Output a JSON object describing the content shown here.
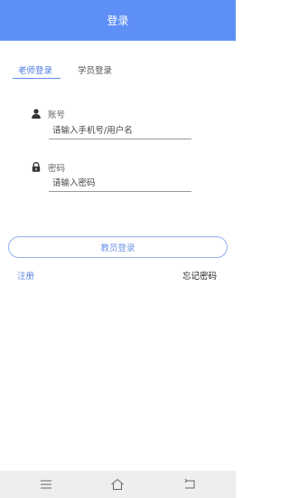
{
  "header": {
    "title": "登录"
  },
  "tabs": [
    {
      "label": "老师登录",
      "active": true
    },
    {
      "label": "学员登录",
      "active": false
    }
  ],
  "account": {
    "icon": "user-icon",
    "label": "账号",
    "placeholder": "请输入手机号/用户名",
    "value": ""
  },
  "password": {
    "icon": "lock-icon",
    "label": "密码",
    "placeholder": "请输入密码",
    "value": ""
  },
  "login_button": {
    "label": "教员登录"
  },
  "links": {
    "register": "注册",
    "forgot": "忘记密码"
  },
  "navbar": {
    "icons": [
      "menu-icon",
      "home-icon",
      "back-icon"
    ]
  },
  "colors": {
    "header_bg": "#5e8ff6",
    "accent": "#5e8ff6",
    "button_border": "#8fb0f0",
    "navbar_bg": "#eeeeee"
  }
}
